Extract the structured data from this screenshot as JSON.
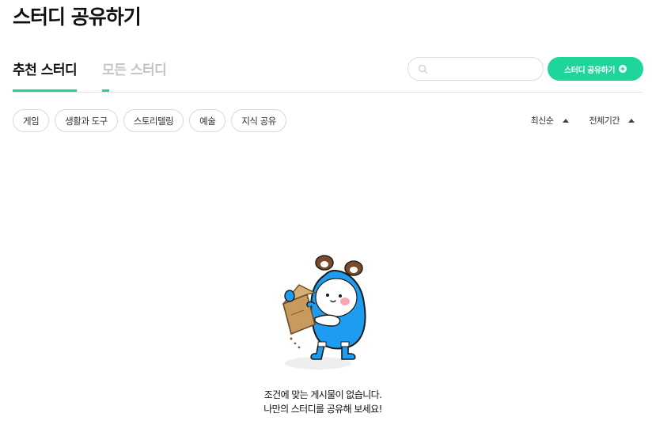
{
  "page": {
    "title": "스터디 공유하기"
  },
  "tabs": [
    {
      "label": "추천 스터디",
      "active": true
    },
    {
      "label": "모든 스터디",
      "active": false
    }
  ],
  "search": {
    "placeholder": "",
    "value": "",
    "icon": "search-icon"
  },
  "share_button": {
    "label": "스터디 공유하기",
    "icon": "plus-circle-icon"
  },
  "categories": [
    "게임",
    "생활과 도구",
    "스토리텔링",
    "예술",
    "지식 공유"
  ],
  "sorts": [
    {
      "label": "최신순",
      "icon": "caret-up-icon"
    },
    {
      "label": "전체기간",
      "icon": "caret-up-icon"
    }
  ],
  "empty_state": {
    "illustration": "mascot-carrying-box",
    "line1": "조건에 맞는 게시물이 없습니다.",
    "line2": "나만의 스터디를 공유해 보세요!"
  },
  "colors": {
    "accent": "#1ed69b",
    "mascot_blue": "#1e9df0",
    "box_brown": "#c89a5e"
  }
}
